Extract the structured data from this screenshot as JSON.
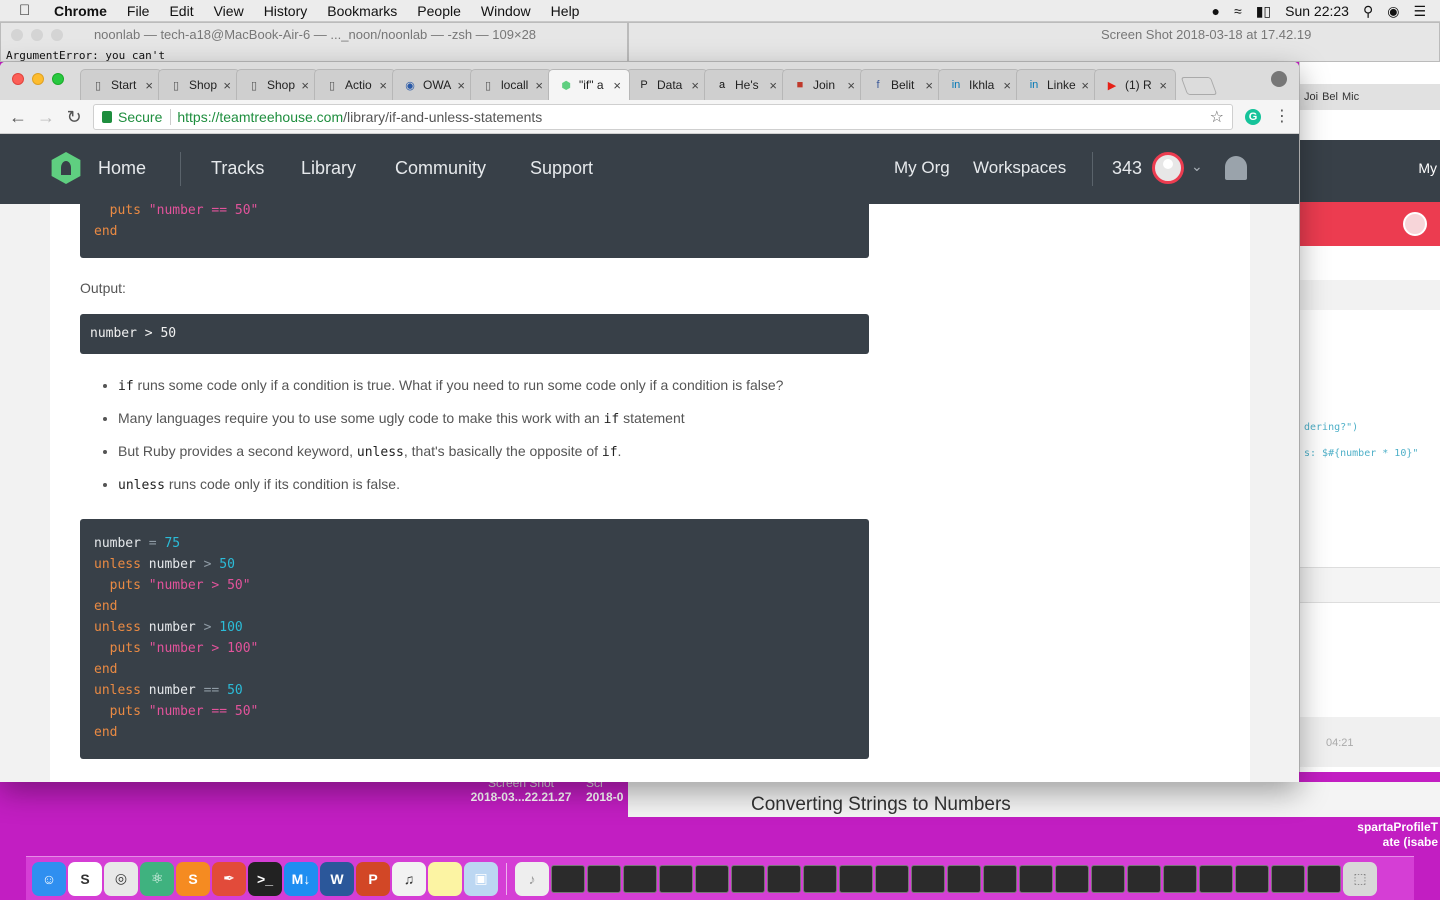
{
  "menubar": {
    "apple": "",
    "items": [
      "Chrome",
      "File",
      "Edit",
      "View",
      "History",
      "Bookmarks",
      "People",
      "Window",
      "Help"
    ],
    "clock": "Sun 22:23"
  },
  "terminal": {
    "title": "noonlab — tech-a18@MacBook-Air-6 — ..._noon/noonlab — -zsh — 109×28",
    "line": "ArgumentError: you can't"
  },
  "preview": {
    "title": "Screen Shot 2018-03-18 at 17.42.19"
  },
  "tabs": [
    {
      "favicon": "page",
      "title": "Start"
    },
    {
      "favicon": "page",
      "title": "Shop"
    },
    {
      "favicon": "page",
      "title": "Shop"
    },
    {
      "favicon": "page",
      "title": "Actio"
    },
    {
      "favicon": "globe",
      "title": "OWA"
    },
    {
      "favicon": "page",
      "title": "locall"
    },
    {
      "favicon": "treehouse",
      "title": "\"if\" a"
    },
    {
      "favicon": "p",
      "title": "Data"
    },
    {
      "favicon": "amazon",
      "title": "He's"
    },
    {
      "favicon": "wx",
      "title": "Join"
    },
    {
      "favicon": "facebook",
      "title": "Belit"
    },
    {
      "favicon": "linkedin",
      "title": "Ikhla"
    },
    {
      "favicon": "linkedin",
      "title": "Linke"
    },
    {
      "favicon": "youtube",
      "title": "(1) R"
    }
  ],
  "omnibox": {
    "secure_label": "Secure",
    "url_host": "https://teamtreehouse.com",
    "url_path": "/library/if-and-unless-statements"
  },
  "site_nav": {
    "home": "Home",
    "links": [
      "Tracks",
      "Library",
      "Community",
      "Support"
    ],
    "right_links": [
      "My Org",
      "Workspaces"
    ],
    "points": "343"
  },
  "code_top": {
    "lines": [
      {
        "kw": "  puts ",
        "str": "\"number == 50\""
      },
      {
        "kw": "end",
        "str": ""
      }
    ]
  },
  "output_label": "Output:",
  "output_block": "number > 50",
  "bullets": [
    {
      "code": "if",
      "text": " runs some code only if a condition is true. What if you need to run some code only if a condition is false?"
    },
    {
      "pre": "Many languages require you to use some ugly code to make this work with an ",
      "code": "if",
      "post": " statement"
    },
    {
      "pre": "But Ruby provides a second keyword, ",
      "code": "unless",
      "mid": ", that's basically the opposite of ",
      "code2": "if",
      "post": "."
    },
    {
      "code": "unless",
      "text": " runs code only if its condition is false."
    }
  ],
  "code_bottom": [
    "number = 75",
    "unless number > 50",
    "  puts \"number > 50\"",
    "end",
    "unless number > 100",
    "  puts \"number > 100\"",
    "end",
    "unless number == 50",
    "  puts \"number == 50\"",
    "end"
  ],
  "right_strip": {
    "tabs": [
      "Joi",
      "Bel",
      "Mic"
    ],
    "my": "My",
    "code1": "dering?\")",
    "code2": "s: $#{number * 10}\"",
    "time": "04:21"
  },
  "desktop": {
    "screenshot1_a": "Screen Shot",
    "screenshot1_b": "2018-03...22.21.27",
    "screenshot2_a": "Scr",
    "screenshot2_b": "2018-0",
    "card_title": "Converting Strings to Numbers",
    "sparta_a": "spartaProfileT",
    "sparta_b": "ate (isabe"
  },
  "dock_apps": [
    "finder",
    "sublime-s",
    "chrome",
    "atom",
    "sublime",
    "paw",
    "terminal",
    "macdown",
    "word",
    "powerpoint",
    "itunes",
    "notes",
    "preview"
  ]
}
